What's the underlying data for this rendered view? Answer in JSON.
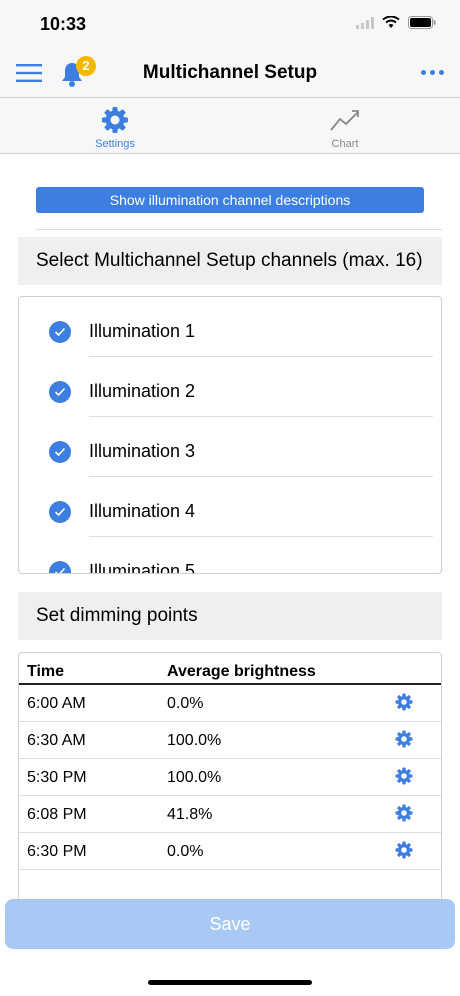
{
  "status_bar": {
    "time": "10:33"
  },
  "nav": {
    "title": "Multichannel Setup",
    "notification_count": "2",
    "menu_icon": "hamburger-menu-icon",
    "bell_icon": "bell-icon",
    "more_icon": "ellipsis-icon"
  },
  "tabs": [
    {
      "label": "Settings",
      "icon": "gear-icon",
      "active": true
    },
    {
      "label": "Chart",
      "icon": "chart-line-icon",
      "active": false
    }
  ],
  "descriptions_button": "Show illumination channel descriptions",
  "channels_section": {
    "title": "Select Multichannel Setup channels (max. 16)",
    "items": [
      {
        "label": "Illumination 1",
        "checked": true
      },
      {
        "label": "Illumination 2",
        "checked": true
      },
      {
        "label": "Illumination 3",
        "checked": true
      },
      {
        "label": "Illumination 4",
        "checked": true
      },
      {
        "label": "Illumination 5",
        "checked": true
      }
    ]
  },
  "dimming_section": {
    "title": "Set dimming points",
    "columns": [
      "Time",
      "Average brightness"
    ],
    "rows": [
      {
        "time": "6:00 AM",
        "brightness": "0.0%"
      },
      {
        "time": "6:30 AM",
        "brightness": "100.0%"
      },
      {
        "time": "5:30 PM",
        "brightness": "100.0%"
      },
      {
        "time": "6:08 PM",
        "brightness": "41.8%"
      },
      {
        "time": "6:30 PM",
        "brightness": "0.0%"
      }
    ]
  },
  "save_button": "Save",
  "colors": {
    "accent": "#3d7fe0",
    "badge": "#f5b800",
    "save_disabled": "#a9c9f5"
  }
}
